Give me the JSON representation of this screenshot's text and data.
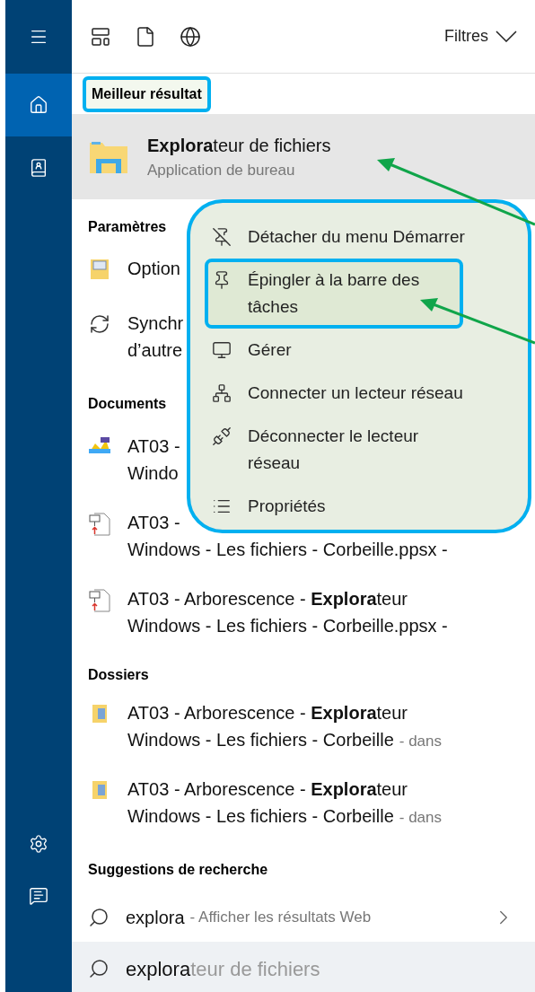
{
  "sidebar": {
    "items": [
      {
        "kind": "menu",
        "selected": false
      },
      {
        "kind": "home",
        "selected": true
      },
      {
        "kind": "notebook",
        "selected": false
      }
    ],
    "bottom_items": [
      {
        "kind": "settings"
      },
      {
        "kind": "feedback"
      }
    ]
  },
  "toolbar": {
    "filters": "Filtres"
  },
  "best_result": {
    "header": "Meilleur résultat",
    "header_highlighted": true,
    "title": "**Explora**teur de fichiers",
    "subtitle": "Application de bureau",
    "arrow": true
  },
  "sections": [
    {
      "header": "Paramètres",
      "items": [
        {
          "kind": "settings-page",
          "lines": [
            "Option"
          ]
        },
        {
          "kind": "sync",
          "lines": [
            "Synchr",
            "d’autre"
          ]
        }
      ]
    },
    {
      "header": "Documents",
      "items": [
        {
          "kind": "image-doc",
          "lines": [
            "AT03 -",
            "Windo"
          ]
        },
        {
          "kind": "slideshow",
          "lines": [
            "AT03 -",
            "Windows - Les fichiers - Corbeille.ppsx -"
          ]
        },
        {
          "kind": "slideshow",
          "lines": [
            "AT03 - Arborescence - **Explora**teur",
            "Windows - Les fichiers - Corbeille.ppsx -"
          ]
        }
      ]
    },
    {
      "header": "Dossiers",
      "items": [
        {
          "kind": "folder",
          "lines": [
            "AT03 - Arborescence - **Explora**teur",
            "Windows - Les fichiers - Corbeille"
          ],
          "suffix": "- dans"
        },
        {
          "kind": "folder",
          "lines": [
            "AT03 - Arborescence - **Explora**teur",
            "Windows - Les fichiers - Corbeille"
          ],
          "suffix": "- dans"
        }
      ]
    },
    {
      "header": "Suggestions de recherche",
      "items": [
        {
          "kind": "web",
          "query": "explora",
          "hint": "- Afficher les résultats Web"
        }
      ]
    }
  ],
  "search": {
    "typed": "explora",
    "completion": "teur de fichiers"
  },
  "context_menu": {
    "highlighted": true,
    "items": [
      {
        "kind": "unpin",
        "lines": [
          "Détacher du menu Démarrer"
        ],
        "highlighted": false,
        "arrow": false
      },
      {
        "kind": "pin",
        "lines": [
          "Épingler à la barre des",
          "tâches"
        ],
        "highlighted": true,
        "arrow": true
      },
      {
        "kind": "manage",
        "lines": [
          "Gérer"
        ],
        "highlighted": false,
        "arrow": false
      },
      {
        "kind": "map-drive",
        "lines": [
          "Connecter un lecteur réseau"
        ],
        "highlighted": false,
        "arrow": false
      },
      {
        "kind": "unmap-drive",
        "lines": [
          "Déconnecter le lecteur",
          "réseau"
        ],
        "highlighted": false,
        "arrow": false
      },
      {
        "kind": "properties",
        "lines": [
          "Propriétés"
        ],
        "highlighted": false,
        "arrow": false
      }
    ]
  }
}
